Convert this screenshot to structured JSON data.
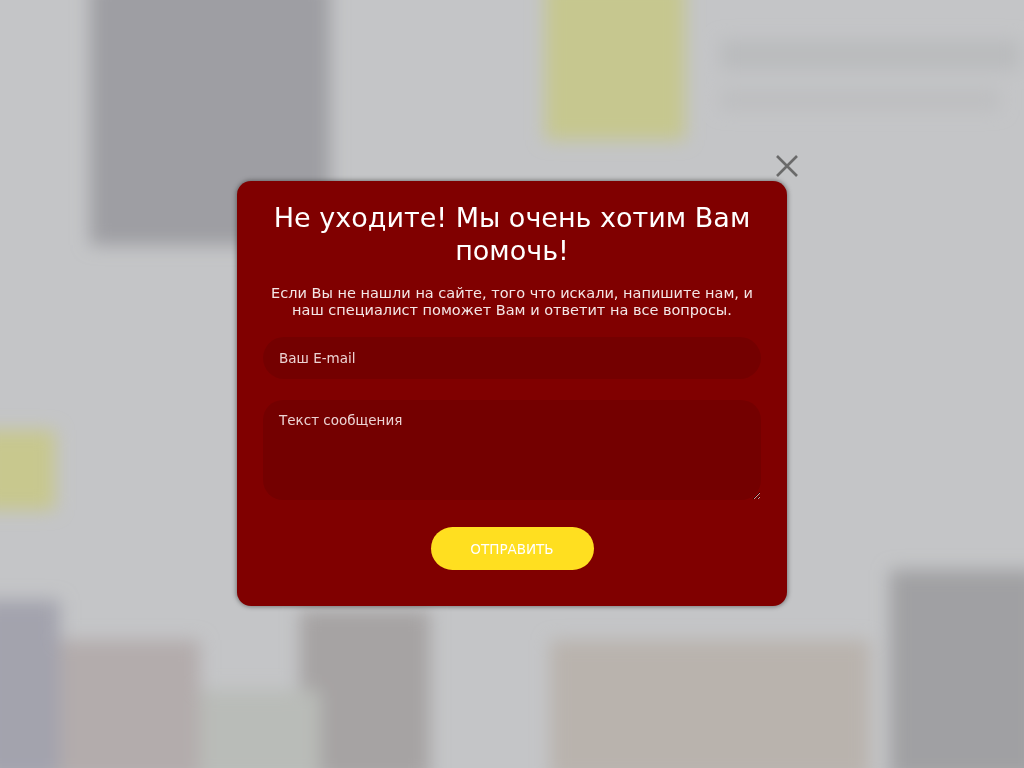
{
  "popup": {
    "title": "Не уходите! Мы очень хотим Вам помочь!",
    "text": "Если Вы не нашли на сайте, того что искали, напишите нам, и наш специалист поможет Вам и ответит на все вопросы.",
    "fields": [
      {
        "kind": "input",
        "placeholder": "Ваш E-mail"
      },
      {
        "kind": "textarea",
        "placeholder": "Текст сообщения"
      }
    ],
    "submit_button": "ОТПРАВИТЬ"
  }
}
